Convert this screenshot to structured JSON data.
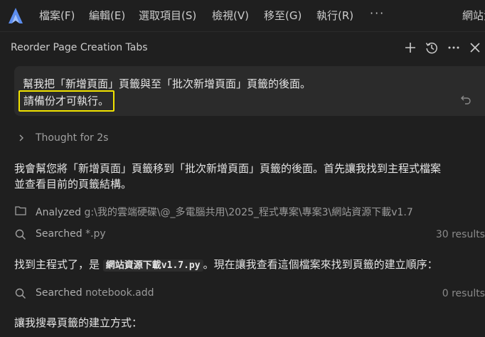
{
  "menubar": {
    "items": [
      "檔案(F)",
      "編輯(E)",
      "選取項目(S)",
      "檢視(V)",
      "移至(G)",
      "執行(R)"
    ],
    "more": "···",
    "right_title": "網站資"
  },
  "panel": {
    "title": "Reorder Page Creation Tabs"
  },
  "prompt": {
    "line1": "幫我把「新增頁面」頁籤與至「批次新增頁面」頁籤的後面。",
    "line2": "請備份才可執行。"
  },
  "thought": {
    "label": "Thought for 2s"
  },
  "messages": {
    "intro_line1": "我會幫您將「新增頁面」頁籤移到「批次新增頁面」頁籤的後面。首先讓我找到主程式檔案",
    "intro_line2": "並查看目前的頁籤結構。",
    "found_prefix": "找到主程式了，是",
    "found_code": "網站資源下載v1.7.py",
    "found_suffix": "。現在讓我查看這個檔案來找到頁籤的建立順序：",
    "search_how": "讓我搜尋頁籤的建立方式："
  },
  "steps": {
    "analyzed_label": "Analyzed",
    "analyzed_path": "g:\\我的雲端硬碟\\@_多電腦共用\\2025_程式專案\\專案3\\網站資源下載v1.7",
    "search1_label": "Searched",
    "search1_query": "*.py",
    "search1_count": "30 results",
    "search2_label": "Searched",
    "search2_query": "notebook.add",
    "search2_count": "0 results"
  }
}
